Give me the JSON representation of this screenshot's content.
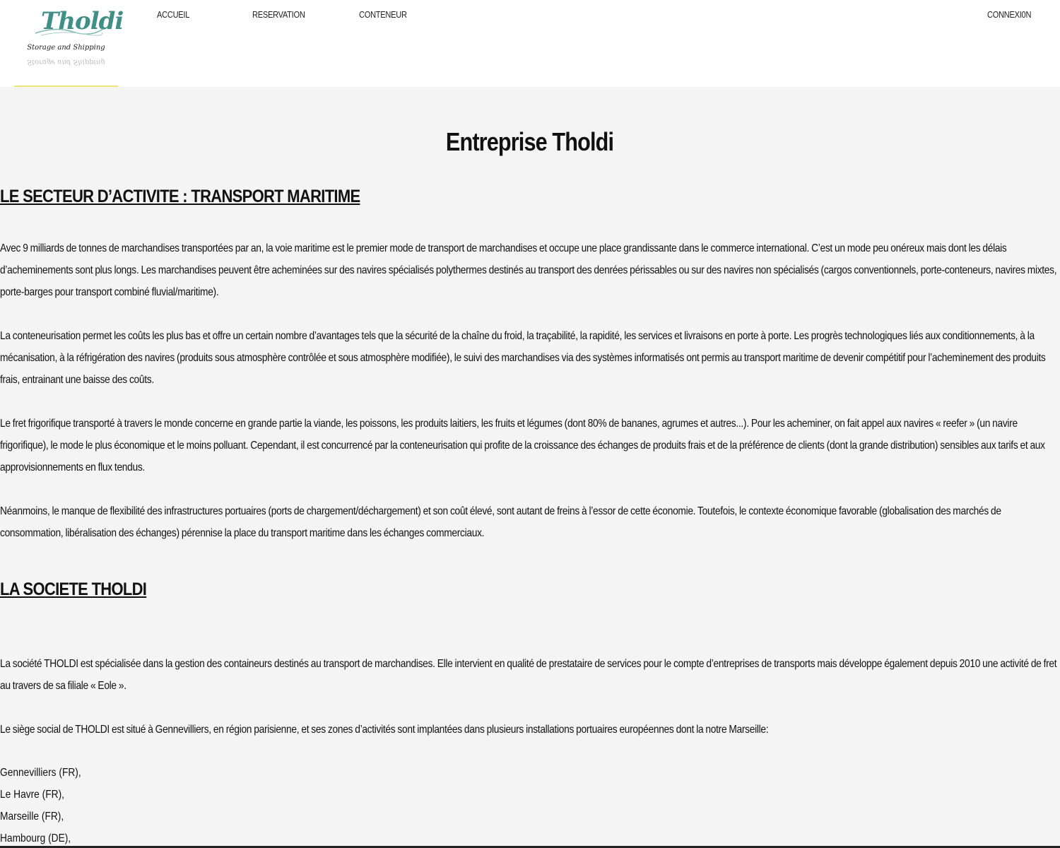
{
  "logo": {
    "word": "Tholdi",
    "tagline": "Storage and Shipping"
  },
  "nav": {
    "accueil": "ACCUEIL",
    "reservation": "RESERVATION",
    "conteneur": "CONTENEUR",
    "connexion": "CONNEXI0N"
  },
  "main": {
    "title": "Entreprise Tholdi",
    "section1": {
      "heading": "LE SECTEUR D’ACTIVITE : TRANSPORT MARITIME",
      "paragraphs": [
        "Avec 9 milliards de tonnes de marchandises transportées par an, la voie maritime est le premier mode de transport de marchandises et occupe une place grandissante dans le commerce international. C’est un mode peu onéreux mais dont les délais d’acheminements sont plus longs. Les marchandises peuvent être acheminées sur des navires spécialisés polythermes destinés au transport des denrées périssables ou sur des navires non spécialisés (cargos conventionnels, porte-conteneurs, navires mixtes, porte-barges pour transport combiné fluvial/maritime).",
        "La conteneurisation permet les coûts les plus bas et offre un certain nombre d’avantages tels que la sécurité de la chaîne du froid, la traçabilité, la rapidité, les services et livraisons en porte à porte. Les progrès technologiques liés aux conditionnements, à la mécanisation, à la réfrigération des navires (produits sous atmosphère contrôlée et sous atmosphère modifiée), le suivi des marchandises via des systèmes informatisés ont permis au transport maritime de devenir compétitif pour l’acheminement des produits frais, entrainant une baisse des coûts.",
        "Le fret frigorifique transporté à travers le monde concerne en grande partie la viande, les poissons, les produits laitiers, les fruits et légumes (dont 80% de bananes, agrumes et autres...). Pour les acheminer, on fait appel aux navires « reefer » (un navire frigorifique), le mode le plus économique et le moins polluant. Cependant, il est concurrencé par la conteneurisation qui profite de la croissance des échanges de produits frais et de la préférence de clients (dont la grande distribution) sensibles aux tarifs et aux approvisionnements en flux tendus.",
        "Néanmoins, le manque de flexibilité des infrastructures portuaires (ports de chargement/déchargement) et son coût élevé, sont autant de freins à l’essor de cette économie. Toutefois, le contexte économique favorable (globalisation des marchés de consommation, libéralisation des échanges) pérennise la place du transport maritime dans les échanges commerciaux."
      ]
    },
    "section2": {
      "heading": "LA SOCIETE THOLDI",
      "paragraphs": [
        "La société THOLDI est spécialisée dans la gestion des containeurs destinés au transport de marchandises. Elle intervient en qualité de prestataire de services pour le compte d’entreprises de transports mais développe également depuis 2010 une activité de fret au travers de sa filiale « Eole ».",
        "Le siège social de THOLDI est situé à Gennevilliers, en région parisienne, et ses zones d’activités sont implantées dans plusieurs installations portuaires européennes dont la notre Marseille:"
      ],
      "locations": [
        "Gennevilliers (FR),",
        "Le Havre (FR),",
        "Marseille (FR),",
        "Hambourg (DE),"
      ]
    }
  }
}
